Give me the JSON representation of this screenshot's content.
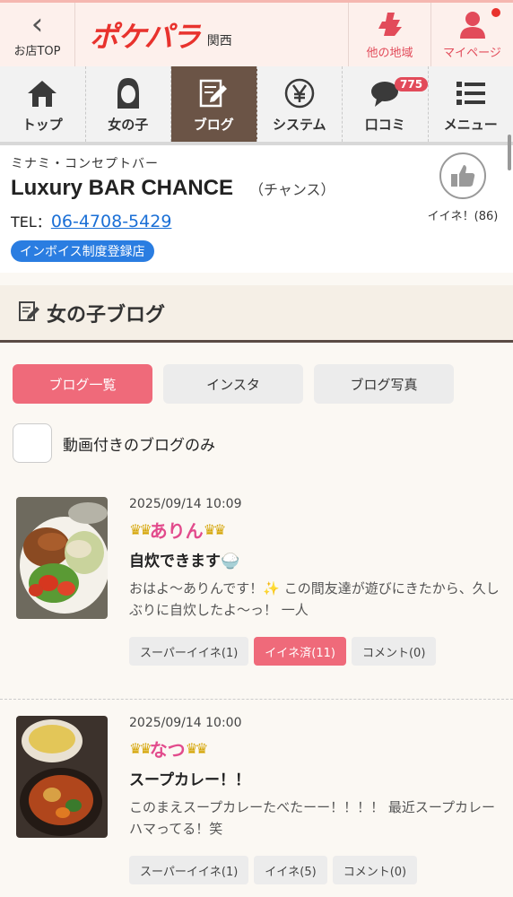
{
  "header": {
    "back_label": "お店TOP",
    "logo": "ポケパラ",
    "region": "関西",
    "area_label": "他の地域",
    "mypage_label": "マイページ"
  },
  "nav": {
    "items": [
      {
        "label": "トップ",
        "icon": "home-icon"
      },
      {
        "label": "女の子",
        "icon": "girl-icon"
      },
      {
        "label": "ブログ",
        "icon": "blog-icon",
        "active": true
      },
      {
        "label": "システム",
        "icon": "yen-icon"
      },
      {
        "label": "口コミ",
        "icon": "review-icon",
        "badge": "775"
      },
      {
        "label": "メニュー",
        "icon": "menu-icon"
      }
    ]
  },
  "shop": {
    "category": "ミナミ・コンセプトバー",
    "name": "Luxury BAR CHANCE",
    "kana": "（チャンス）",
    "tel_label": "TEL：",
    "tel": "06-4708-5429",
    "invoice": "インボイス制度登録店",
    "like_label": "イイネ！(86)"
  },
  "section": {
    "title": "女の子ブログ"
  },
  "filters": [
    {
      "label": "ブログ一覧",
      "active": true
    },
    {
      "label": "インスタ"
    },
    {
      "label": "ブログ写真"
    }
  ],
  "video_only_label": "動画付きのブログのみ",
  "posts": [
    {
      "date": "2025/09/14 10:09",
      "girl": "ありん",
      "title": "自炊できます🍚",
      "excerpt": "おはよ〜ありんです！✨ この間友達が遊びにきたから、久しぶりに自炊したよ〜っ！ 一人",
      "super": "スーパーイイネ(1)",
      "like": "イイネ済(11)",
      "comment": "コメント(0)"
    },
    {
      "date": "2025/09/14 10:00",
      "girl": "なつ",
      "title": "スープカレー！！",
      "excerpt": "このまえスープカレーたべたーー！！！！ 最近スープカレーハマってる！笑",
      "super": "スーパーイイネ(1)",
      "like": "イイネ(5)",
      "comment": "コメント(0)"
    }
  ]
}
